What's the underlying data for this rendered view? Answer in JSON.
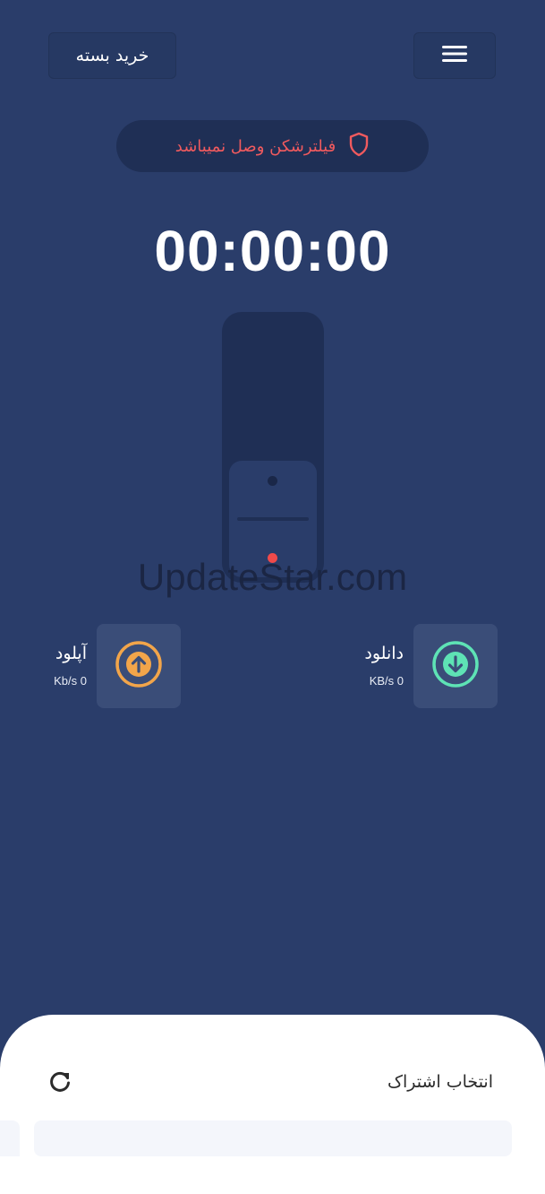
{
  "header": {
    "buy_label": "خرید بسته",
    "menu_icon": "hamburger-menu-icon"
  },
  "status": {
    "text": "فیلترشکن وصل نمیباشد",
    "icon": "shield-icon",
    "color": "#f05a5e"
  },
  "timer": {
    "value": "00:00:00"
  },
  "connection_switch": {
    "state": "off"
  },
  "watermark": {
    "text": "UpdateStar.com"
  },
  "stats": {
    "upload": {
      "title": "آپلود",
      "value": "Kb/s 0",
      "icon": "arrow-up-circle-icon",
      "color": "#f2a54a"
    },
    "download": {
      "title": "دانلود",
      "value": "KB/s 0",
      "icon": "arrow-down-circle-icon",
      "color": "#5ee3b5"
    }
  },
  "bottom_sheet": {
    "title": "انتخاب اشتراک",
    "refresh_icon": "refresh-icon"
  },
  "colors": {
    "background": "#2a3d6a",
    "panel": "#1f2f55",
    "tile": "#3a4d78"
  }
}
